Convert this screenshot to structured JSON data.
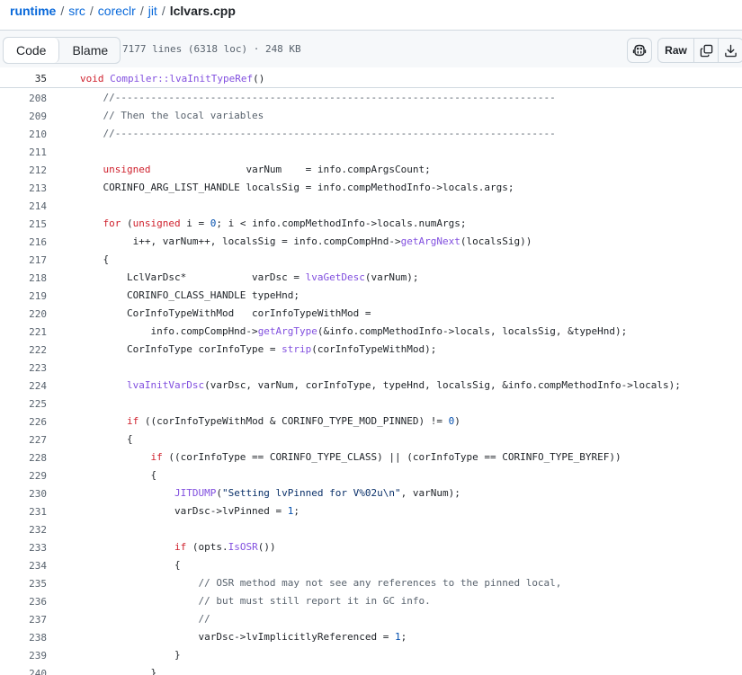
{
  "breadcrumb": {
    "repo": "runtime",
    "path": [
      "src",
      "coreclr",
      "jit"
    ],
    "file": "lclvars.cpp",
    "separator": "/"
  },
  "toolbar": {
    "code_tab": "Code",
    "blame_tab": "Blame",
    "file_info": "7177 lines (6318 loc) · 248 KB",
    "raw_label": "Raw"
  },
  "sticky": {
    "line": "35",
    "tokens": [
      {
        "c": "k",
        "v": "void "
      },
      {
        "c": "f",
        "v": "Compiler::lvaInitTypeRef"
      },
      {
        "c": "t",
        "v": "()"
      }
    ]
  },
  "lines": [
    {
      "n": "208",
      "tokens": [
        {
          "c": "c",
          "v": "    //--------------------------------------------------------------------------"
        }
      ]
    },
    {
      "n": "209",
      "tokens": [
        {
          "c": "c",
          "v": "    // Then the local variables"
        }
      ]
    },
    {
      "n": "210",
      "tokens": [
        {
          "c": "c",
          "v": "    //--------------------------------------------------------------------------"
        }
      ]
    },
    {
      "n": "211",
      "tokens": []
    },
    {
      "n": "212",
      "tokens": [
        {
          "c": "k",
          "v": "    unsigned"
        },
        {
          "c": "t",
          "v": "                varNum    = info.compArgsCount;"
        }
      ]
    },
    {
      "n": "213",
      "tokens": [
        {
          "c": "t",
          "v": "    CORINFO_ARG_LIST_HANDLE localsSig = info.compMethodInfo->locals.args;"
        }
      ]
    },
    {
      "n": "214",
      "tokens": []
    },
    {
      "n": "215",
      "tokens": [
        {
          "c": "k",
          "v": "    for"
        },
        {
          "c": "t",
          "v": " ("
        },
        {
          "c": "k",
          "v": "unsigned"
        },
        {
          "c": "t",
          "v": " i = "
        },
        {
          "c": "n",
          "v": "0"
        },
        {
          "c": "t",
          "v": "; i < info.compMethodInfo->locals.numArgs;"
        }
      ]
    },
    {
      "n": "216",
      "tokens": [
        {
          "c": "t",
          "v": "         i++, varNum++, localsSig = info.compCompHnd->"
        },
        {
          "c": "f",
          "v": "getArgNext"
        },
        {
          "c": "t",
          "v": "(localsSig))"
        }
      ]
    },
    {
      "n": "217",
      "tokens": [
        {
          "c": "t",
          "v": "    {"
        }
      ]
    },
    {
      "n": "218",
      "tokens": [
        {
          "c": "t",
          "v": "        LclVarDsc*           varDsc = "
        },
        {
          "c": "f",
          "v": "lvaGetDesc"
        },
        {
          "c": "t",
          "v": "(varNum);"
        }
      ]
    },
    {
      "n": "219",
      "tokens": [
        {
          "c": "t",
          "v": "        CORINFO_CLASS_HANDLE typeHnd;"
        }
      ]
    },
    {
      "n": "220",
      "tokens": [
        {
          "c": "t",
          "v": "        CorInfoTypeWithMod   corInfoTypeWithMod ="
        }
      ]
    },
    {
      "n": "221",
      "tokens": [
        {
          "c": "t",
          "v": "            info.compCompHnd->"
        },
        {
          "c": "f",
          "v": "getArgType"
        },
        {
          "c": "t",
          "v": "(&info.compMethodInfo->locals, localsSig, &typeHnd);"
        }
      ]
    },
    {
      "n": "222",
      "tokens": [
        {
          "c": "t",
          "v": "        CorInfoType corInfoType = "
        },
        {
          "c": "f",
          "v": "strip"
        },
        {
          "c": "t",
          "v": "(corInfoTypeWithMod);"
        }
      ]
    },
    {
      "n": "223",
      "tokens": []
    },
    {
      "n": "224",
      "tokens": [
        {
          "c": "f",
          "v": "        lvaInitVarDsc"
        },
        {
          "c": "t",
          "v": "(varDsc, varNum, corInfoType, typeHnd, localsSig, &info.compMethodInfo->locals);"
        }
      ]
    },
    {
      "n": "225",
      "tokens": []
    },
    {
      "n": "226",
      "tokens": [
        {
          "c": "k",
          "v": "        if"
        },
        {
          "c": "t",
          "v": " ((corInfoTypeWithMod & CORINFO_TYPE_MOD_PINNED) != "
        },
        {
          "c": "n",
          "v": "0"
        },
        {
          "c": "t",
          "v": ")"
        }
      ]
    },
    {
      "n": "227",
      "tokens": [
        {
          "c": "t",
          "v": "        {"
        }
      ]
    },
    {
      "n": "228",
      "tokens": [
        {
          "c": "k",
          "v": "            if"
        },
        {
          "c": "t",
          "v": " ((corInfoType == CORINFO_TYPE_CLASS) || (corInfoType == CORINFO_TYPE_BYREF))"
        }
      ]
    },
    {
      "n": "229",
      "tokens": [
        {
          "c": "t",
          "v": "            {"
        }
      ]
    },
    {
      "n": "230",
      "tokens": [
        {
          "c": "f",
          "v": "                JITDUMP"
        },
        {
          "c": "t",
          "v": "("
        },
        {
          "c": "s",
          "v": "\"Setting lvPinned for V%02u\\n\""
        },
        {
          "c": "t",
          "v": ", varNum);"
        }
      ]
    },
    {
      "n": "231",
      "tokens": [
        {
          "c": "t",
          "v": "                varDsc->lvPinned = "
        },
        {
          "c": "n",
          "v": "1"
        },
        {
          "c": "t",
          "v": ";"
        }
      ]
    },
    {
      "n": "232",
      "tokens": []
    },
    {
      "n": "233",
      "tokens": [
        {
          "c": "k",
          "v": "                if"
        },
        {
          "c": "t",
          "v": " (opts."
        },
        {
          "c": "f",
          "v": "IsOSR"
        },
        {
          "c": "t",
          "v": "())"
        }
      ]
    },
    {
      "n": "234",
      "tokens": [
        {
          "c": "t",
          "v": "                {"
        }
      ]
    },
    {
      "n": "235",
      "tokens": [
        {
          "c": "c",
          "v": "                    // OSR method may not see any references to the pinned local,"
        }
      ]
    },
    {
      "n": "236",
      "tokens": [
        {
          "c": "c",
          "v": "                    // but must still report it in GC info."
        }
      ]
    },
    {
      "n": "237",
      "tokens": [
        {
          "c": "c",
          "v": "                    //"
        }
      ]
    },
    {
      "n": "238",
      "tokens": [
        {
          "c": "t",
          "v": "                    varDsc->lvImplicitlyReferenced = "
        },
        {
          "c": "n",
          "v": "1"
        },
        {
          "c": "t",
          "v": ";"
        }
      ]
    },
    {
      "n": "239",
      "tokens": [
        {
          "c": "t",
          "v": "                }"
        }
      ]
    },
    {
      "n": "240",
      "tokens": [
        {
          "c": "t",
          "v": "            }"
        }
      ]
    }
  ],
  "colors": {
    "keyword": "#cf222e",
    "comment": "#59636e",
    "function": "#8250df",
    "number": "#0550ae",
    "string": "#0a3069",
    "link": "#0969da"
  },
  "icons": [
    "copilot-icon",
    "copy-icon",
    "download-icon"
  ]
}
